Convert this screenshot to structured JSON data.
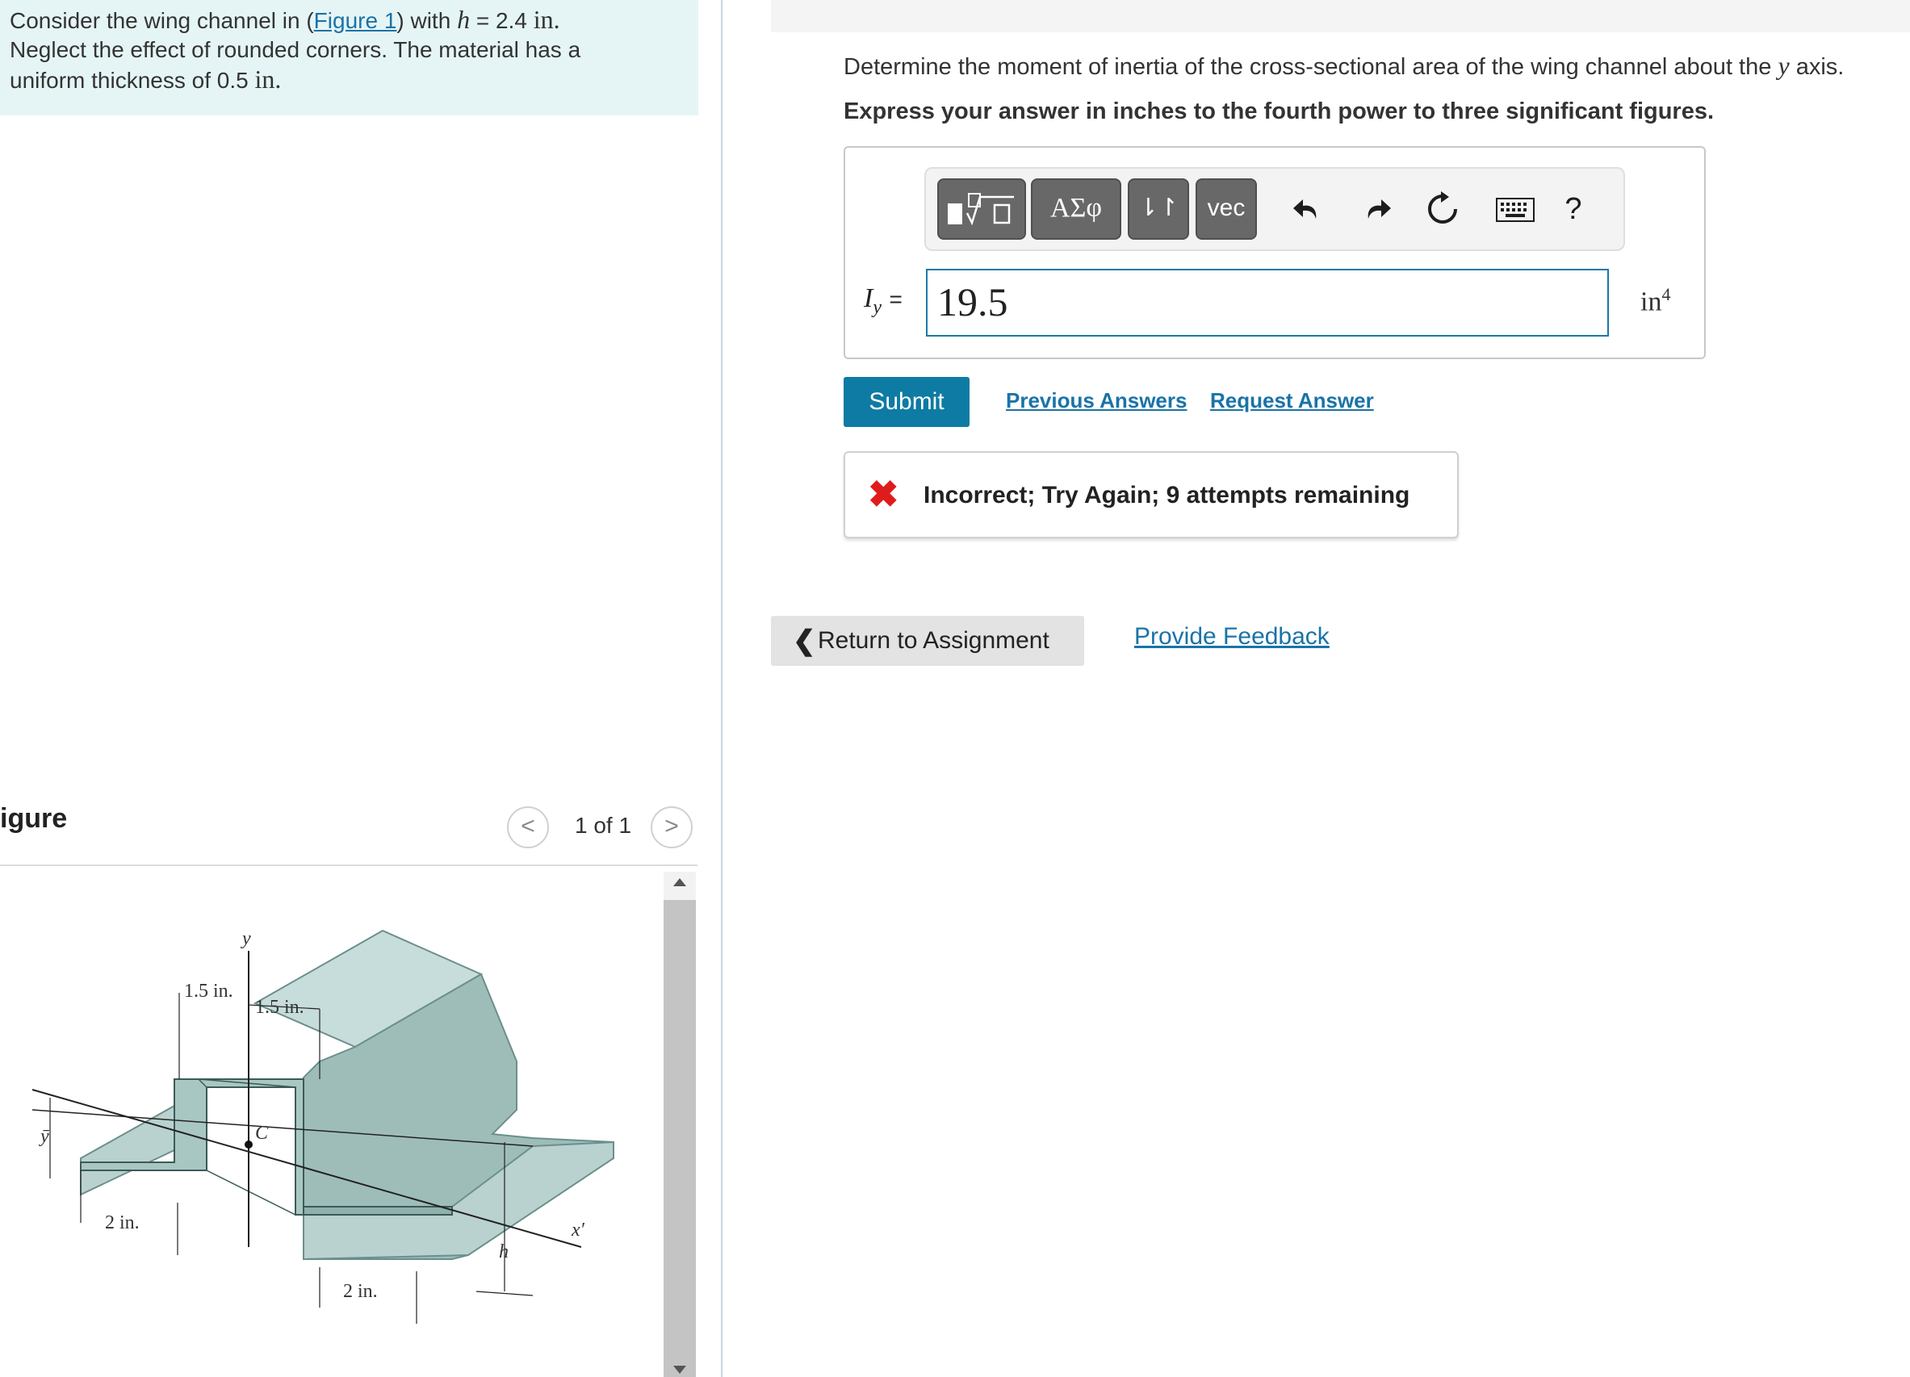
{
  "problem": {
    "p1": "Consider the wing channel in (",
    "figure_link": "Figure 1",
    "p2": ") with ",
    "h_symbol": "h",
    "p3": " = 2.4 ",
    "unit": "in.",
    "line2": "Neglect the effect of rounded corners. The material has a",
    "line3": "uniform thickness of 0.5 ",
    "unit2": "in."
  },
  "figure_panel": {
    "heading": "igure",
    "count": "1 of 1",
    "prev_icon": "chevron-left-icon",
    "next_icon": "chevron-right-icon",
    "labels": {
      "y_axis": "y",
      "dim_top_left": "1.5 in.",
      "dim_top_right": "1.5 in.",
      "centroid": "C",
      "ybar": "ȳ",
      "dim_bottom_left": "2 in.",
      "dim_bottom_right": "2 in.",
      "h": "h",
      "x_prime": "x′"
    }
  },
  "question": {
    "text_before": "Determine the moment of inertia of the cross-sectional area of the wing channel about the ",
    "axis": "y",
    "text_after": " axis.",
    "instruction": "Express your answer in inches to the fourth power to three significant figures."
  },
  "toolbar": {
    "templates_icon": "fraction-root-template-icon",
    "greek": "ΑΣφ",
    "arrows": "⇂↾",
    "vec": "vec",
    "undo_icon": "undo-icon",
    "redo_icon": "redo-icon",
    "reset_icon": "reset-icon",
    "keyboard_icon": "keyboard-icon",
    "help": "?"
  },
  "answer": {
    "label_var": "I",
    "label_sub": "y",
    "label_eq": "=",
    "value": "19.5",
    "unit": "in",
    "unit_exp": "4"
  },
  "actions": {
    "submit": "Submit",
    "previous_answers": "Previous Answers",
    "request_answer": "Request Answer"
  },
  "feedback": {
    "icon": "x-mark-icon",
    "text": "Incorrect; Try Again; 9 attempts remaining",
    "color": "#e01b1b"
  },
  "footer": {
    "return": "Return to Assignment",
    "provide_feedback": "Provide Feedback"
  },
  "colors": {
    "accent": "#0d7ba3",
    "link": "#1a73a8",
    "problem_bg": "#e5f5f5"
  }
}
